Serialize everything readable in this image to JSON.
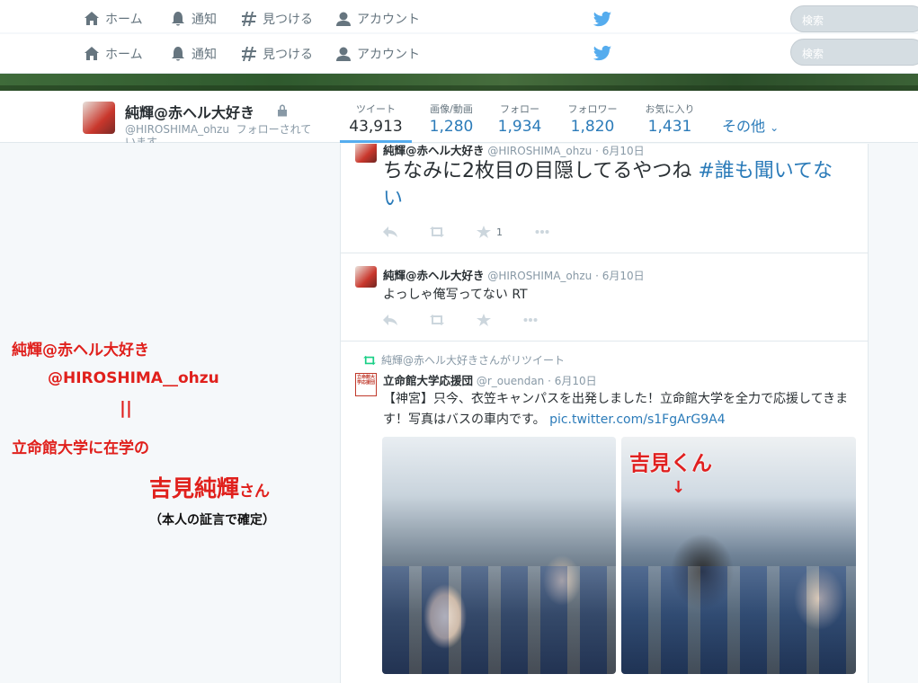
{
  "nav_bars": [
    {
      "home": "ホーム",
      "notifications": "通知",
      "discover": "見つける",
      "account": "アカウント",
      "search_placeholder": "検索"
    },
    {
      "home": "ホーム",
      "notifications": "通知",
      "discover": "見つける",
      "account": "アカウント",
      "search_placeholder": "検索"
    }
  ],
  "profile": {
    "name": "純輝@赤ヘル大好き",
    "handle": "@HIROSHIMA_ohzu",
    "follows_you": "フォローされています",
    "stats": [
      {
        "label": "ツイート",
        "value": "43,913"
      },
      {
        "label": "画像/動画",
        "value": "1,280"
      },
      {
        "label": "フォロー",
        "value": "1,934"
      },
      {
        "label": "フォロワー",
        "value": "1,820"
      },
      {
        "label": "お気に入り",
        "value": "1,431"
      }
    ],
    "more_label": "その他"
  },
  "tweets": [
    {
      "name": "純輝@赤ヘル大好き",
      "handle": "@HIROSHIMA_ohzu",
      "date": "6月10日",
      "text": "ちなみに2枚目の目隠してるやつね ",
      "hashtag": "#誰も聞いてない",
      "favorite_count": "1"
    },
    {
      "name": "純輝@赤ヘル大好き",
      "handle": "@HIROSHIMA_ohzu",
      "date": "6月10日",
      "text": "よっしゃ俺写ってない RT"
    },
    {
      "retweeted_by": "純輝@赤ヘル大好きさんがリツイート",
      "name": "立命館大学応援団",
      "handle": "@r_ouendan",
      "date": "6月10日",
      "avatar_text": "立命館大学応援団",
      "text": "【神宮】只今、衣笠キャンパスを出発しました！立命館大学を全力で応援してきます！写真はバスの車内です。",
      "link": "pic.twitter.com/s1FgArG9A4",
      "photo2_label": "吉見くん",
      "photo2_arrow": "↓"
    }
  ],
  "annotation": {
    "line1": "純輝@赤ヘル大好き",
    "line2": "@HIROSHIMA__ohzu",
    "line3": "||",
    "line4": "立命館大学に在学の",
    "line5_name": "吉見純輝",
    "line5_suffix": "さん",
    "line6": "（本人の証言で確定）"
  },
  "colors": {
    "accent": "#55acee",
    "link": "#2b7bb9",
    "annotation_red": "#e0201c",
    "retweet_green": "#19cf86"
  }
}
